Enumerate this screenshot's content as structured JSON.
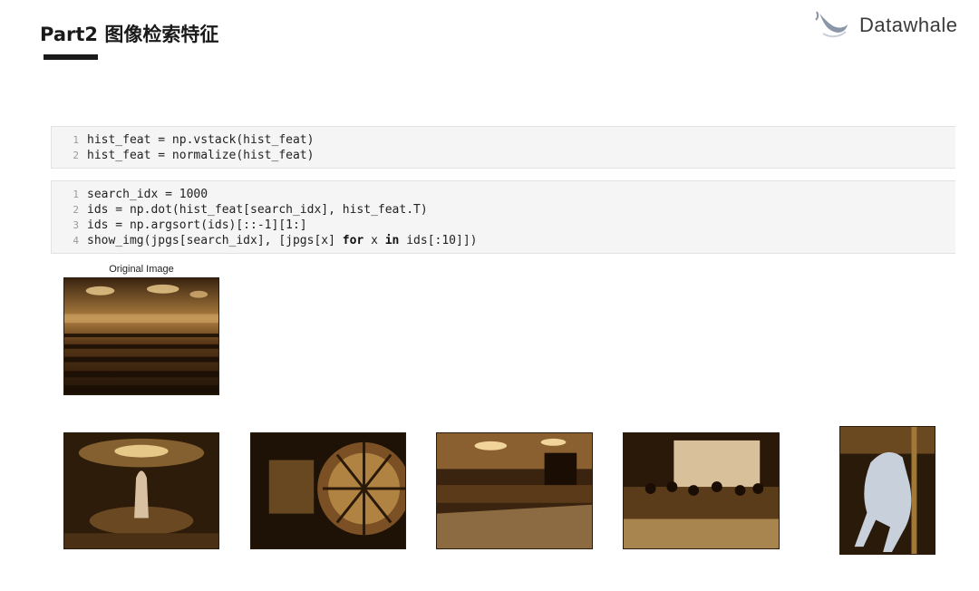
{
  "header": {
    "title": "Part2 图像检索特征",
    "brand": "Datawhale"
  },
  "cells": [
    {
      "lines": [
        {
          "n": "1",
          "code": "hist_feat = np.vstack(hist_feat)"
        },
        {
          "n": "2",
          "code": "hist_feat = normalize(hist_feat)"
        }
      ]
    },
    {
      "lines": [
        {
          "n": "1",
          "code": "search_idx = 1000"
        },
        {
          "n": "2",
          "code": "ids = np.dot(hist_feat[search_idx], hist_feat.T)"
        },
        {
          "n": "3",
          "code": "ids = np.argsort(ids)[::-1][1:]"
        },
        {
          "n": "4",
          "code_pre": "show_img(jpgs[search_idx], [jpgs[x] ",
          "kw1": "for",
          "code_mid": " x ",
          "kw2": "in",
          "code_post": " ids[:10]])"
        }
      ]
    }
  ],
  "output": {
    "original_label": "Original Image"
  },
  "colors": {
    "sepia_dark": "#2a1a08",
    "sepia_mid": "#7a5428",
    "sepia_light": "#d8b070"
  }
}
